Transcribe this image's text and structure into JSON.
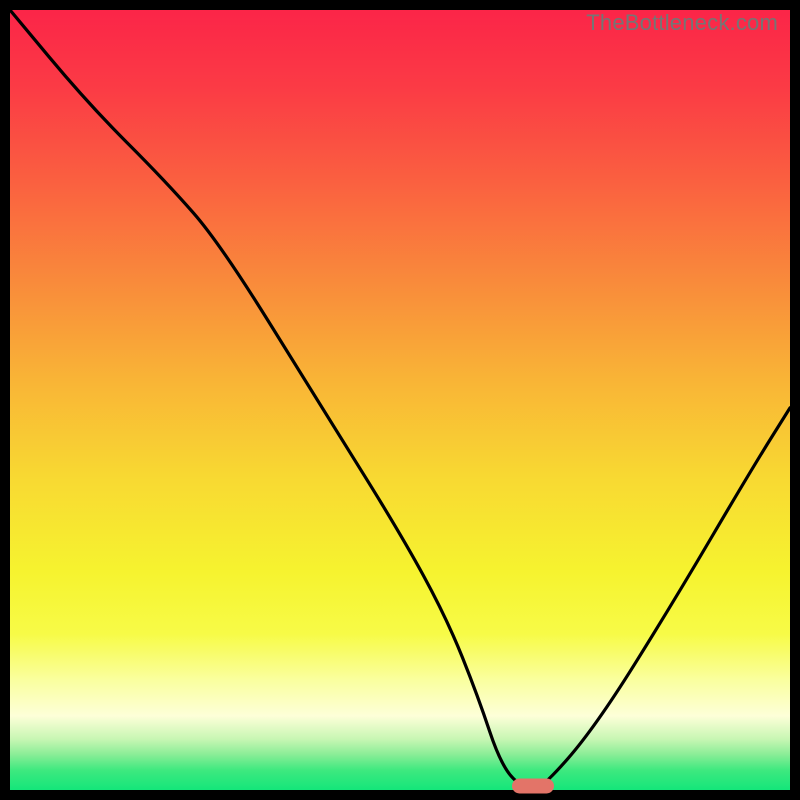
{
  "watermark": "TheBottleneck.com",
  "colors": {
    "frame": "#000000",
    "marker": "#e37468",
    "green": "#14e67a",
    "curve": "#000000"
  },
  "chart_data": {
    "type": "line",
    "title": "",
    "xlabel": "",
    "ylabel": "",
    "xlim": [
      0,
      100
    ],
    "ylim": [
      0,
      100
    ],
    "grid": false,
    "legend": false,
    "background": "vertical-gradient red→yellow→green",
    "series": [
      {
        "name": "bottleneck-curve",
        "x": [
          0,
          10,
          20,
          27,
          40,
          50,
          56,
          60,
          63,
          66,
          68,
          75,
          85,
          95,
          100
        ],
        "y": [
          100,
          88,
          78,
          70,
          49,
          33,
          22,
          12,
          3,
          0,
          0,
          8,
          24,
          41,
          49
        ]
      }
    ],
    "marker": {
      "x": 67,
      "y": 0
    }
  }
}
